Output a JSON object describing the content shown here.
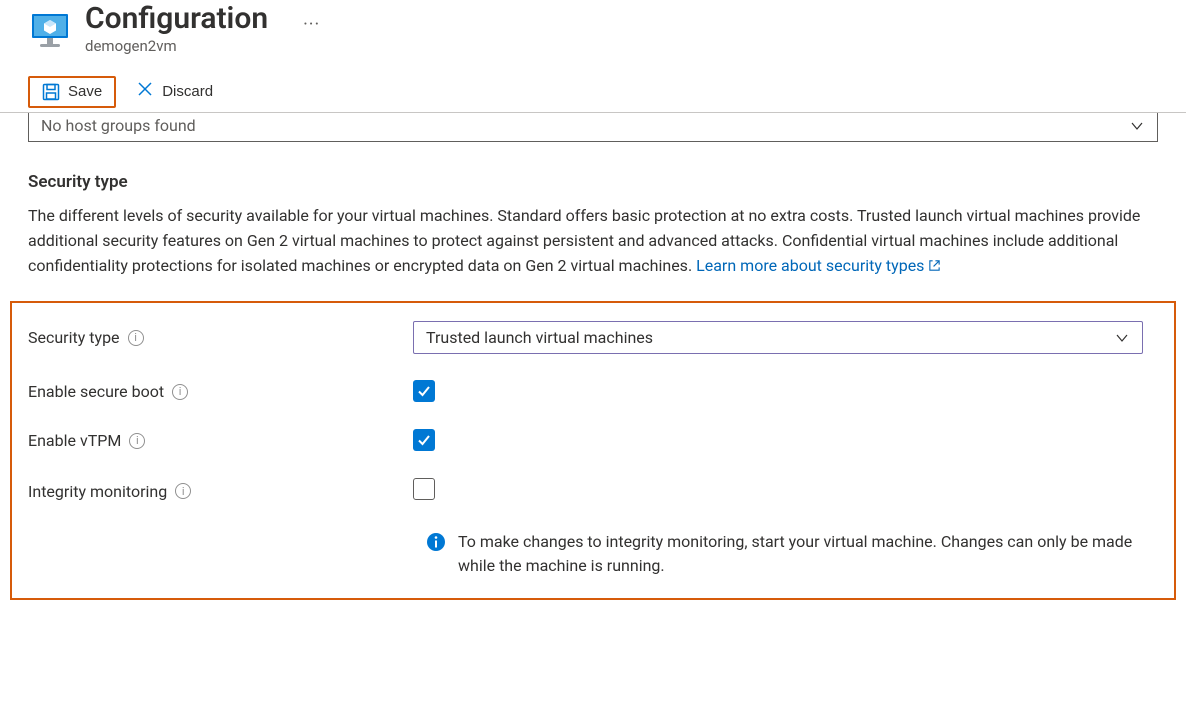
{
  "header": {
    "title": "Configuration",
    "subtitle": "demogen2vm"
  },
  "toolbar": {
    "save_label": "Save",
    "discard_label": "Discard"
  },
  "host_group_dropdown": {
    "value": "No host groups found"
  },
  "security": {
    "heading": "Security type",
    "description_prefix": "The different levels of security available for your virtual machines. Standard offers basic protection at no extra costs. Trusted launch virtual machines provide additional security features on Gen 2 virtual machines to protect against persistent and advanced attacks. Confidential virtual machines include additional confidentiality protections for isolated machines or encrypted data on Gen 2 virtual machines. ",
    "learn_more_label": "Learn more about security types",
    "fields": {
      "security_type_label": "Security type",
      "security_type_value": "Trusted launch virtual machines",
      "secure_boot_label": "Enable secure boot",
      "secure_boot_checked": true,
      "vtpm_label": "Enable vTPM",
      "vtpm_checked": true,
      "integrity_label": "Integrity monitoring",
      "integrity_checked": false
    },
    "note": "To make changes to integrity monitoring, start your virtual machine. Changes can only be made while the machine is running."
  },
  "icons": {
    "vm": "vm-monitor-icon",
    "save": "save-icon",
    "discard": "close-x-icon",
    "info": "info-circle-icon",
    "chevron_down": "chevron-down-icon",
    "external": "external-link-icon",
    "note_info": "info-solid-icon"
  }
}
